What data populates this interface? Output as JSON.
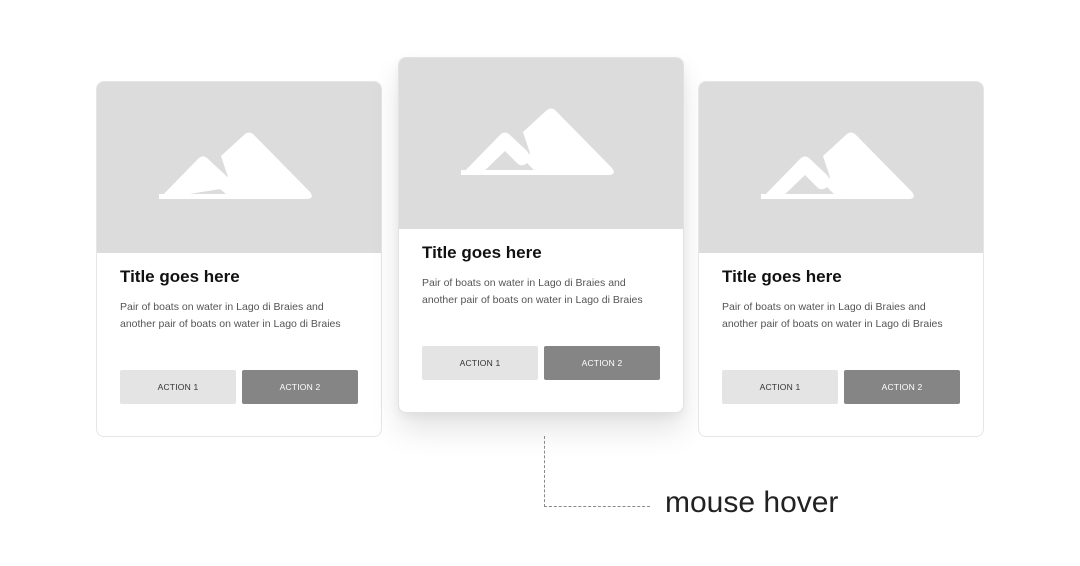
{
  "cards": [
    {
      "title": "Title goes here",
      "description": "Pair of boats on water in Lago di Braies and another pair of boats on water in Lago di Braies",
      "image_icon": "mountain-icon",
      "action1": "ACTION 1",
      "action2": "ACTION 2"
    },
    {
      "title": "Title goes here",
      "description": "Pair of boats on water in Lago di Braies and another pair of boats on water in Lago di Braies",
      "image_icon": "mountain-icon",
      "action1": "ACTION 1",
      "action2": "ACTION 2"
    },
    {
      "title": "Title goes here",
      "description": "Pair of boats on water in Lago di Braies and another pair of boats on water in Lago di Braies",
      "image_icon": "mountain-icon",
      "action1": "ACTION 1",
      "action2": "ACTION 2"
    }
  ],
  "annotation": {
    "label": "mouse hover"
  },
  "colors": {
    "placeholder_bg": "#dcdcdc",
    "icon": "#ffffff",
    "secondary_button": "#e4e4e4",
    "primary_button": "#858585"
  }
}
